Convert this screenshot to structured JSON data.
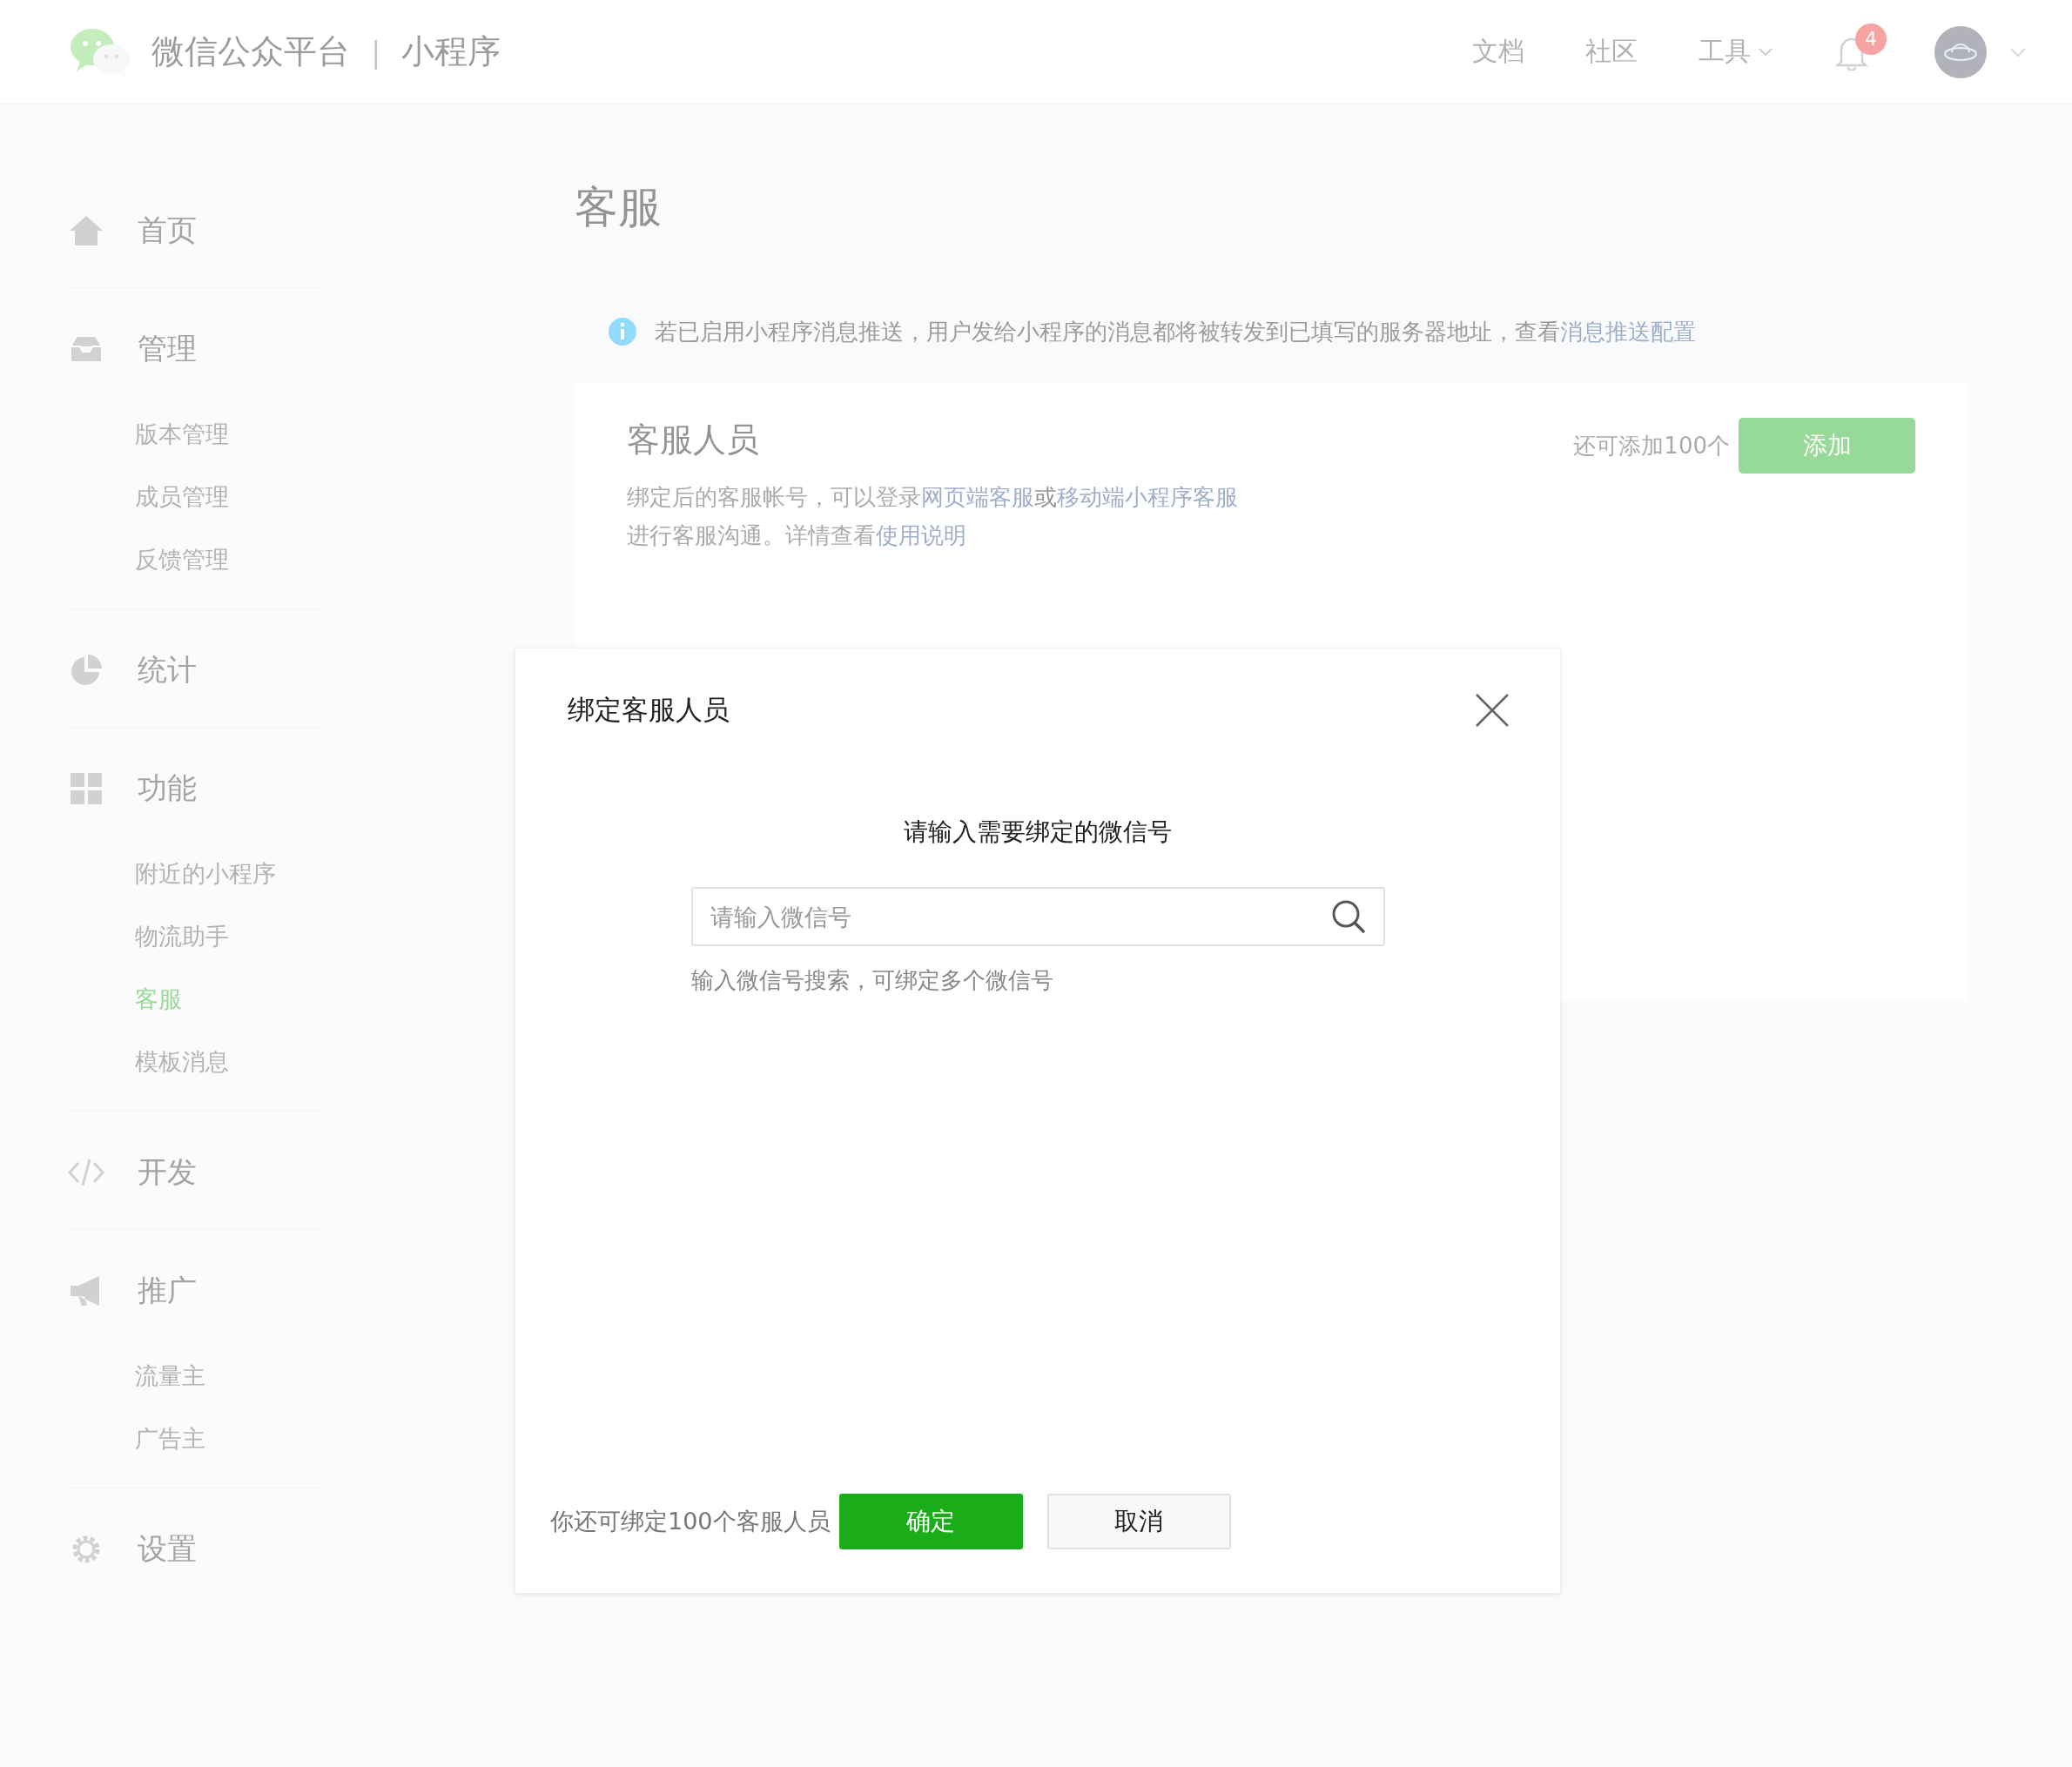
{
  "header": {
    "brand": "微信公众平台",
    "separator": "|",
    "product": "小程序",
    "nav": [
      {
        "label": "文档",
        "dropdown": false
      },
      {
        "label": "社区",
        "dropdown": false
      },
      {
        "label": "工具",
        "dropdown": true
      }
    ],
    "notification_count": "4"
  },
  "sidebar": {
    "groups": [
      {
        "label": "首页"
      },
      {
        "label": "管理",
        "items": [
          {
            "label": "版本管理",
            "selected": false
          },
          {
            "label": "成员管理",
            "selected": false
          },
          {
            "label": "反馈管理",
            "selected": false
          }
        ]
      },
      {
        "label": "统计"
      },
      {
        "label": "功能",
        "items": [
          {
            "label": "附近的小程序",
            "selected": false
          },
          {
            "label": "物流助手",
            "selected": false
          },
          {
            "label": "客服",
            "selected": true
          },
          {
            "label": "模板消息",
            "selected": false
          }
        ]
      },
      {
        "label": "开发"
      },
      {
        "label": "推广",
        "items": [
          {
            "label": "流量主",
            "selected": false
          },
          {
            "label": "广告主",
            "selected": false
          }
        ]
      },
      {
        "label": "设置"
      }
    ]
  },
  "page": {
    "title": "客服",
    "notice": {
      "text": "若已启用小程序消息推送，用户发给小程序的消息都将被转发到已填写的服务器地址，查看",
      "link": "消息推送配置"
    },
    "card": {
      "title": "客服人员",
      "description_lines": [
        [
          {
            "kind": "text",
            "text": "绑定后的客服帐号，可以登录"
          },
          {
            "kind": "link",
            "text": "网页端客服"
          },
          {
            "kind": "plain",
            "text": "或"
          },
          {
            "kind": "link",
            "text": "移动端小程序客服"
          }
        ],
        [
          {
            "kind": "text",
            "text": "进行客服沟通。详情查看"
          },
          {
            "kind": "link",
            "text": "使用说明"
          }
        ]
      ],
      "quota": "还可添加100个",
      "add_button": "添加"
    }
  },
  "dialog": {
    "title": "绑定客服人员",
    "prompt": "请输入需要绑定的微信号",
    "search": {
      "placeholder": "请输入微信号"
    },
    "hint": "输入微信号搜索，可绑定多个微信号",
    "footer_note": "你还可绑定100个客服人员",
    "buttons": [
      {
        "label": "确定",
        "kind": "primary"
      },
      {
        "label": "取消",
        "kind": "default"
      }
    ]
  }
}
